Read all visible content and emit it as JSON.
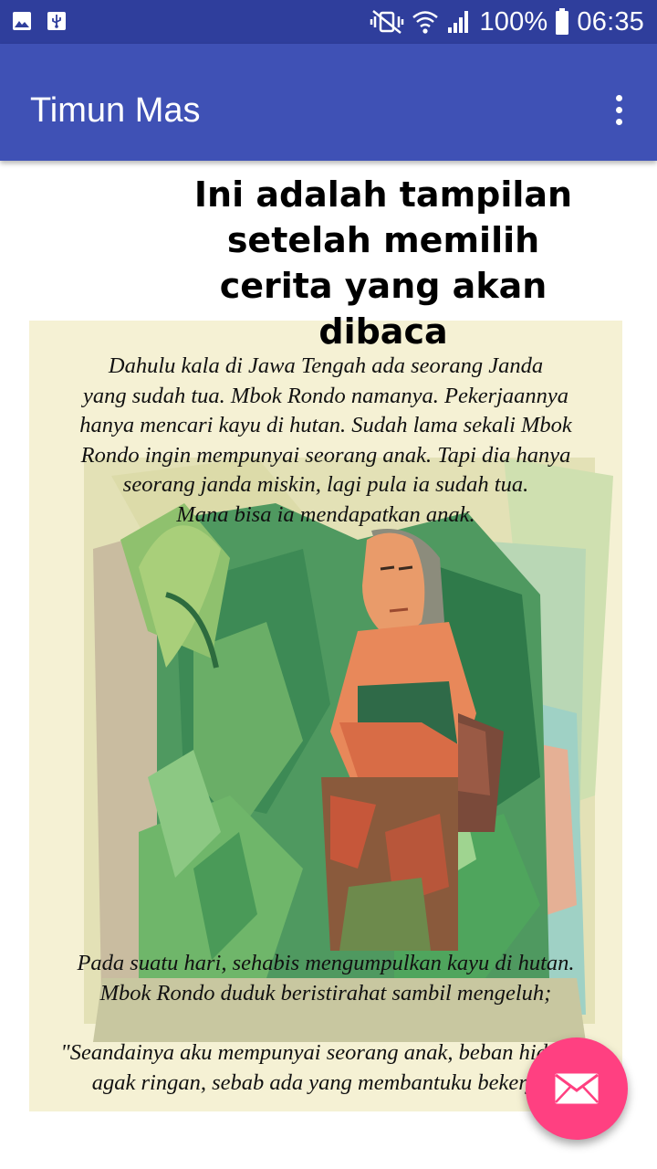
{
  "status_bar": {
    "battery": "100%",
    "time": "06:35",
    "icons": [
      "image-icon",
      "usb-icon",
      "mute-vibrate-icon",
      "wifi-icon",
      "signal-icon",
      "battery-icon"
    ]
  },
  "app_bar": {
    "title": "Timun Mas",
    "overflow_icon": "more-vert-icon"
  },
  "content": {
    "heading": "Ini adalah tampilan\nsetelah memilih\ncerita yang akan\ndibaca",
    "story": {
      "paragraph_1": "Dahulu kala di Jawa Tengah ada seorang Janda\nyang sudah tua. Mbok Rondo namanya. Pekerjaannya\nhanya mencari kayu di hutan. Sudah lama sekali Mbok\nRondo ingin mempunyai seorang anak. Tapi dia hanya\nseorang janda miskin, lagi pula ia sudah tua.\nMana bisa ia mendapatkan anak.",
      "paragraph_2": "Pada suatu hari, sehabis mengumpulkan kayu di hutan.\nMbok Rondo duduk beristirahat sambil mengeluh;",
      "paragraph_3": "\"Seandainya aku mempunyai seorang anak, beban hidupku\nagak ringan, sebab ada yang membantuku bekerja.\""
    }
  },
  "fab": {
    "icon": "mail-icon"
  },
  "colors": {
    "status_bar": "#2f3e9c",
    "app_bar": "#3f51b5",
    "fab": "#ff4081",
    "panel_background": "#f5f1d4"
  }
}
